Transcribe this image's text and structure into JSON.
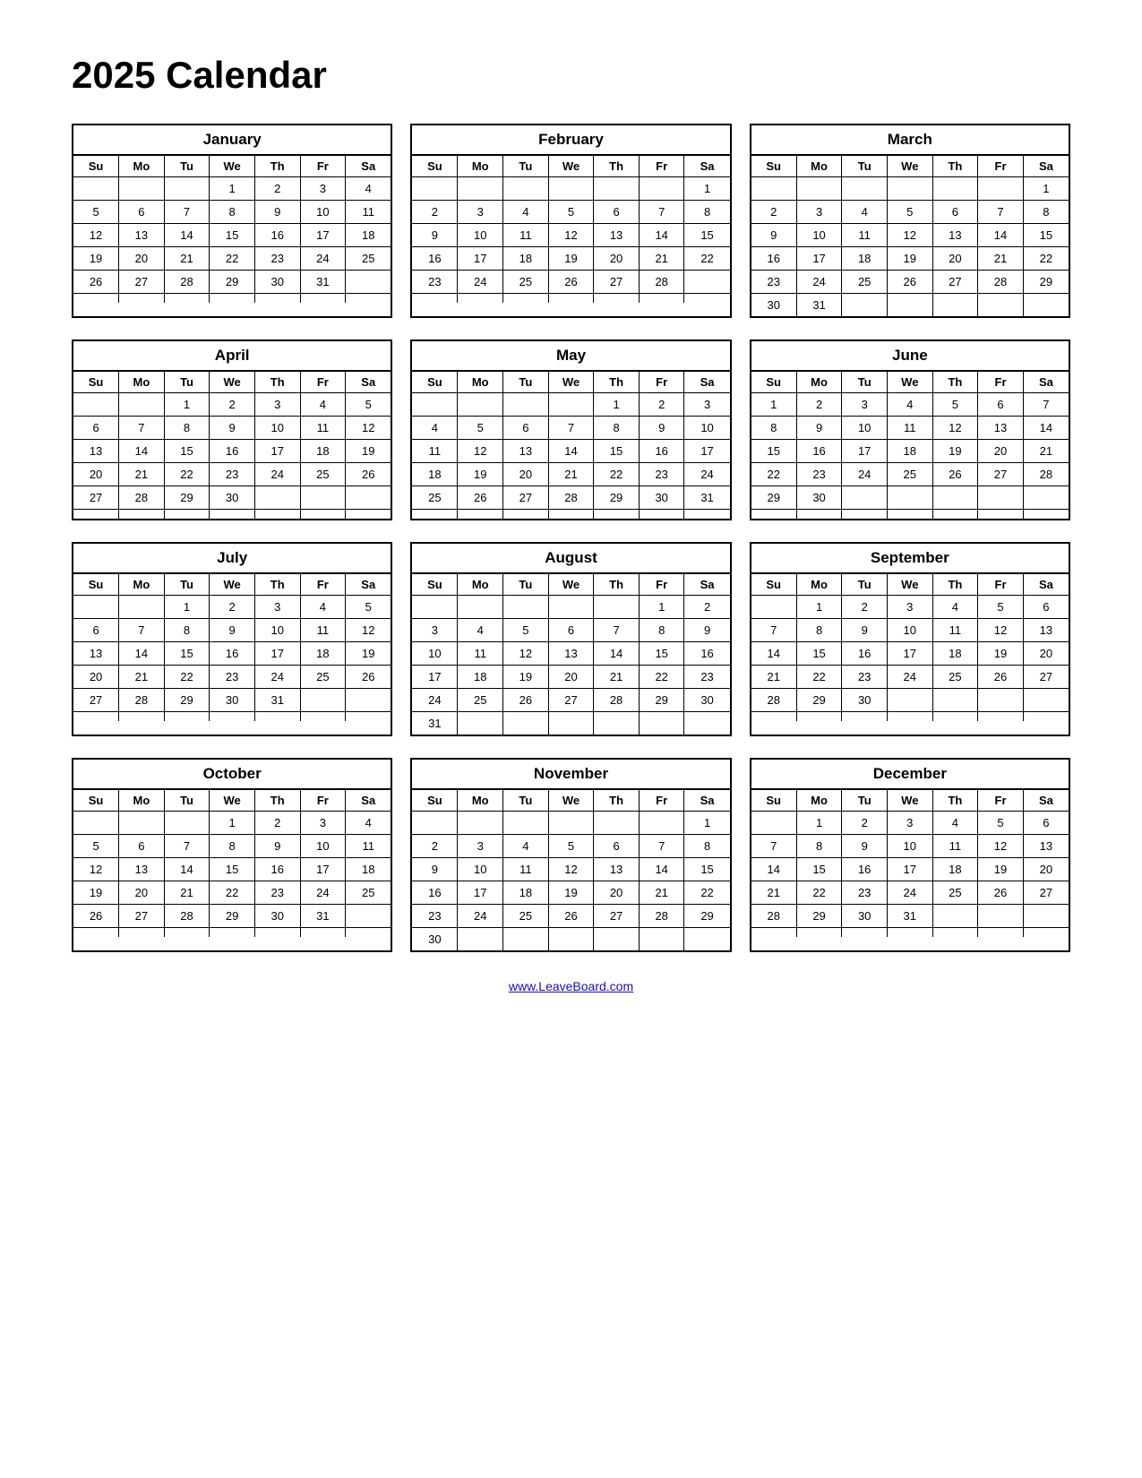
{
  "title": "2025 Calendar",
  "footer_link": "www.LeaveBoard.com",
  "months": [
    {
      "name": "January",
      "days": [
        "Su",
        "Mo",
        "Tu",
        "We",
        "Th",
        "Fr",
        "Sa"
      ],
      "weeks": [
        [
          "",
          "",
          "",
          "1",
          "2",
          "3",
          "4"
        ],
        [
          "5",
          "6",
          "7",
          "8",
          "9",
          "10",
          "11"
        ],
        [
          "12",
          "13",
          "14",
          "15",
          "16",
          "17",
          "18"
        ],
        [
          "19",
          "20",
          "21",
          "22",
          "23",
          "24",
          "25"
        ],
        [
          "26",
          "27",
          "28",
          "29",
          "30",
          "31",
          ""
        ],
        [
          "",
          "",
          "",
          "",
          "",
          "",
          ""
        ]
      ]
    },
    {
      "name": "February",
      "days": [
        "Su",
        "Mo",
        "Tu",
        "We",
        "Th",
        "Fr",
        "Sa"
      ],
      "weeks": [
        [
          "",
          "",
          "",
          "",
          "",
          "",
          "1"
        ],
        [
          "2",
          "3",
          "4",
          "5",
          "6",
          "7",
          "8"
        ],
        [
          "9",
          "10",
          "11",
          "12",
          "13",
          "14",
          "15"
        ],
        [
          "16",
          "17",
          "18",
          "19",
          "20",
          "21",
          "22"
        ],
        [
          "23",
          "24",
          "25",
          "26",
          "27",
          "28",
          ""
        ],
        [
          "",
          "",
          "",
          "",
          "",
          "",
          ""
        ]
      ]
    },
    {
      "name": "March",
      "days": [
        "Su",
        "Mo",
        "Tu",
        "We",
        "Th",
        "Fr",
        "Sa"
      ],
      "weeks": [
        [
          "",
          "",
          "",
          "",
          "",
          "",
          "1"
        ],
        [
          "2",
          "3",
          "4",
          "5",
          "6",
          "7",
          "8"
        ],
        [
          "9",
          "10",
          "11",
          "12",
          "13",
          "14",
          "15"
        ],
        [
          "16",
          "17",
          "18",
          "19",
          "20",
          "21",
          "22"
        ],
        [
          "23",
          "24",
          "25",
          "26",
          "27",
          "28",
          "29"
        ],
        [
          "30",
          "31",
          "",
          "",
          "",
          "",
          ""
        ]
      ]
    },
    {
      "name": "April",
      "days": [
        "Su",
        "Mo",
        "Tu",
        "We",
        "Th",
        "Fr",
        "Sa"
      ],
      "weeks": [
        [
          "",
          "",
          "1",
          "2",
          "3",
          "4",
          "5"
        ],
        [
          "6",
          "7",
          "8",
          "9",
          "10",
          "11",
          "12"
        ],
        [
          "13",
          "14",
          "15",
          "16",
          "17",
          "18",
          "19"
        ],
        [
          "20",
          "21",
          "22",
          "23",
          "24",
          "25",
          "26"
        ],
        [
          "27",
          "28",
          "29",
          "30",
          "",
          "",
          ""
        ],
        [
          "",
          "",
          "",
          "",
          "",
          "",
          ""
        ]
      ]
    },
    {
      "name": "May",
      "days": [
        "Su",
        "Mo",
        "Tu",
        "We",
        "Th",
        "Fr",
        "Sa"
      ],
      "weeks": [
        [
          "",
          "",
          "",
          "",
          "1",
          "2",
          "3"
        ],
        [
          "4",
          "5",
          "6",
          "7",
          "8",
          "9",
          "10"
        ],
        [
          "11",
          "12",
          "13",
          "14",
          "15",
          "16",
          "17"
        ],
        [
          "18",
          "19",
          "20",
          "21",
          "22",
          "23",
          "24"
        ],
        [
          "25",
          "26",
          "27",
          "28",
          "29",
          "30",
          "31"
        ],
        [
          "",
          "",
          "",
          "",
          "",
          "",
          ""
        ]
      ]
    },
    {
      "name": "June",
      "days": [
        "Su",
        "Mo",
        "Tu",
        "We",
        "Th",
        "Fr",
        "Sa"
      ],
      "weeks": [
        [
          "1",
          "2",
          "3",
          "4",
          "5",
          "6",
          "7"
        ],
        [
          "8",
          "9",
          "10",
          "11",
          "12",
          "13",
          "14"
        ],
        [
          "15",
          "16",
          "17",
          "18",
          "19",
          "20",
          "21"
        ],
        [
          "22",
          "23",
          "24",
          "25",
          "26",
          "27",
          "28"
        ],
        [
          "29",
          "30",
          "",
          "",
          "",
          "",
          ""
        ],
        [
          "",
          "",
          "",
          "",
          "",
          "",
          ""
        ]
      ]
    },
    {
      "name": "July",
      "days": [
        "Su",
        "Mo",
        "Tu",
        "We",
        "Th",
        "Fr",
        "Sa"
      ],
      "weeks": [
        [
          "",
          "",
          "1",
          "2",
          "3",
          "4",
          "5"
        ],
        [
          "6",
          "7",
          "8",
          "9",
          "10",
          "11",
          "12"
        ],
        [
          "13",
          "14",
          "15",
          "16",
          "17",
          "18",
          "19"
        ],
        [
          "20",
          "21",
          "22",
          "23",
          "24",
          "25",
          "26"
        ],
        [
          "27",
          "28",
          "29",
          "30",
          "31",
          "",
          ""
        ],
        [
          "",
          "",
          "",
          "",
          "",
          "",
          ""
        ]
      ]
    },
    {
      "name": "August",
      "days": [
        "Su",
        "Mo",
        "Tu",
        "We",
        "Th",
        "Fr",
        "Sa"
      ],
      "weeks": [
        [
          "",
          "",
          "",
          "",
          "",
          "1",
          "2"
        ],
        [
          "3",
          "4",
          "5",
          "6",
          "7",
          "8",
          "9"
        ],
        [
          "10",
          "11",
          "12",
          "13",
          "14",
          "15",
          "16"
        ],
        [
          "17",
          "18",
          "19",
          "20",
          "21",
          "22",
          "23"
        ],
        [
          "24",
          "25",
          "26",
          "27",
          "28",
          "29",
          "30"
        ],
        [
          "31",
          "",
          "",
          "",
          "",
          "",
          ""
        ]
      ]
    },
    {
      "name": "September",
      "days": [
        "Su",
        "Mo",
        "Tu",
        "We",
        "Th",
        "Fr",
        "Sa"
      ],
      "weeks": [
        [
          "",
          "1",
          "2",
          "3",
          "4",
          "5",
          "6"
        ],
        [
          "7",
          "8",
          "9",
          "10",
          "11",
          "12",
          "13"
        ],
        [
          "14",
          "15",
          "16",
          "17",
          "18",
          "19",
          "20"
        ],
        [
          "21",
          "22",
          "23",
          "24",
          "25",
          "26",
          "27"
        ],
        [
          "28",
          "29",
          "30",
          "",
          "",
          "",
          ""
        ],
        [
          "",
          "",
          "",
          "",
          "",
          "",
          ""
        ]
      ]
    },
    {
      "name": "October",
      "days": [
        "Su",
        "Mo",
        "Tu",
        "We",
        "Th",
        "Fr",
        "Sa"
      ],
      "weeks": [
        [
          "",
          "",
          "",
          "1",
          "2",
          "3",
          "4"
        ],
        [
          "5",
          "6",
          "7",
          "8",
          "9",
          "10",
          "11"
        ],
        [
          "12",
          "13",
          "14",
          "15",
          "16",
          "17",
          "18"
        ],
        [
          "19",
          "20",
          "21",
          "22",
          "23",
          "24",
          "25"
        ],
        [
          "26",
          "27",
          "28",
          "29",
          "30",
          "31",
          ""
        ],
        [
          "",
          "",
          "",
          "",
          "",
          "",
          ""
        ]
      ]
    },
    {
      "name": "November",
      "days": [
        "Su",
        "Mo",
        "Tu",
        "We",
        "Th",
        "Fr",
        "Sa"
      ],
      "weeks": [
        [
          "",
          "",
          "",
          "",
          "",
          "",
          "1"
        ],
        [
          "2",
          "3",
          "4",
          "5",
          "6",
          "7",
          "8"
        ],
        [
          "9",
          "10",
          "11",
          "12",
          "13",
          "14",
          "15"
        ],
        [
          "16",
          "17",
          "18",
          "19",
          "20",
          "21",
          "22"
        ],
        [
          "23",
          "24",
          "25",
          "26",
          "27",
          "28",
          "29"
        ],
        [
          "30",
          "",
          "",
          "",
          "",
          "",
          ""
        ]
      ]
    },
    {
      "name": "December",
      "days": [
        "Su",
        "Mo",
        "Tu",
        "We",
        "Th",
        "Fr",
        "Sa"
      ],
      "weeks": [
        [
          "",
          "1",
          "2",
          "3",
          "4",
          "5",
          "6"
        ],
        [
          "7",
          "8",
          "9",
          "10",
          "11",
          "12",
          "13"
        ],
        [
          "14",
          "15",
          "16",
          "17",
          "18",
          "19",
          "20"
        ],
        [
          "21",
          "22",
          "23",
          "24",
          "25",
          "26",
          "27"
        ],
        [
          "28",
          "29",
          "30",
          "31",
          "",
          "",
          ""
        ],
        [
          "",
          "",
          "",
          "",
          "",
          "",
          ""
        ]
      ]
    }
  ]
}
